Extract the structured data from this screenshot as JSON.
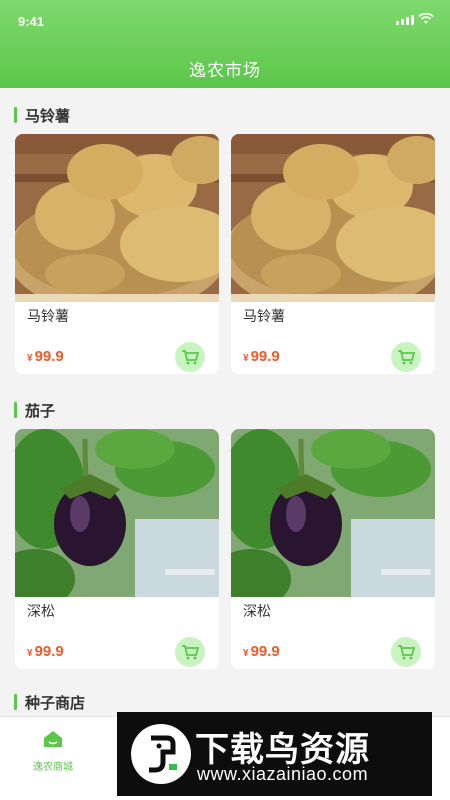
{
  "status": {
    "time": "9:41"
  },
  "header": {
    "title": "逸农市场"
  },
  "sections": [
    {
      "title": "马铃薯",
      "items": [
        {
          "name": "马铃薯",
          "currency": "¥",
          "price": "99.9"
        },
        {
          "name": "马铃薯",
          "currency": "¥",
          "price": "99.9"
        }
      ]
    },
    {
      "title": "茄子",
      "items": [
        {
          "name": "深松",
          "currency": "¥",
          "price": "99.9"
        },
        {
          "name": "深松",
          "currency": "¥",
          "price": "99.9"
        }
      ]
    },
    {
      "title": "种子商店"
    }
  ],
  "bottom_nav": {
    "items": [
      {
        "label": "逸农商城",
        "icon": "home-icon"
      }
    ]
  },
  "watermark": {
    "title": "下载鸟资源",
    "url": "www.xiazainiao.com"
  },
  "colors": {
    "accent": "#5bc64a",
    "price": "#ef5a2a"
  }
}
